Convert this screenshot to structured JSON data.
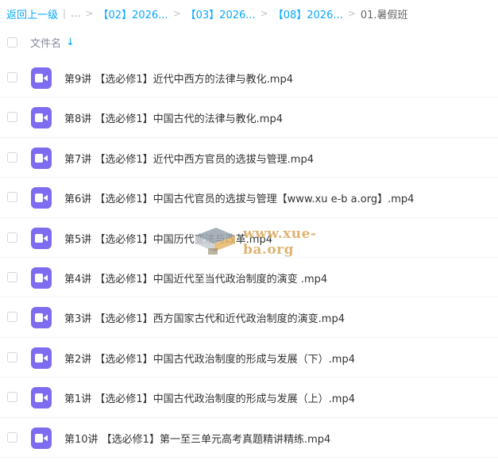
{
  "breadcrumb": {
    "back": "返回上一级",
    "ellipsis": "...",
    "items": [
      "【02】2026...",
      "【03】2026...",
      "【08】2026..."
    ],
    "current": "01.暑假班"
  },
  "header": {
    "column_name": "文件名"
  },
  "files": [
    {
      "name": "第9讲 【选必修1】近代中西方的法律与教化.mp4"
    },
    {
      "name": "第8讲 【选必修1】中国古代的法律与教化.mp4"
    },
    {
      "name": "第7讲 【选必修1】近代中西方官员的选拔与管理.mp4"
    },
    {
      "name": "第6讲 【选必修1】中国古代官员的选拔与管理【www.xu e-b a.org】.mp4"
    },
    {
      "name": "第5讲 【选必修1】中国历代变法与改革.mp4"
    },
    {
      "name": "第4讲 【选必修1】中国近代至当代政治制度的演变 .mp4"
    },
    {
      "name": "第3讲 【选必修1】西方国家古代和近代政治制度的演变.mp4"
    },
    {
      "name": "第2讲 【选必修1】中国古代政治制度的形成与发展（下）.mp4"
    },
    {
      "name": "第1讲 【选必修1】中国古代政治制度的形成与发展（上）.mp4"
    },
    {
      "name": "第10讲 【选必修1】第一至三单元高考真题精讲精练.mp4"
    }
  ],
  "watermark": {
    "text": "www.xue-ba.org"
  },
  "colors": {
    "accent": "#06a7ff",
    "video_icon": "#7d6cf0"
  },
  "icons": {
    "file": "video-file-icon",
    "sort": "arrow-down-icon",
    "watermark": "book-stack-logo-icon"
  }
}
